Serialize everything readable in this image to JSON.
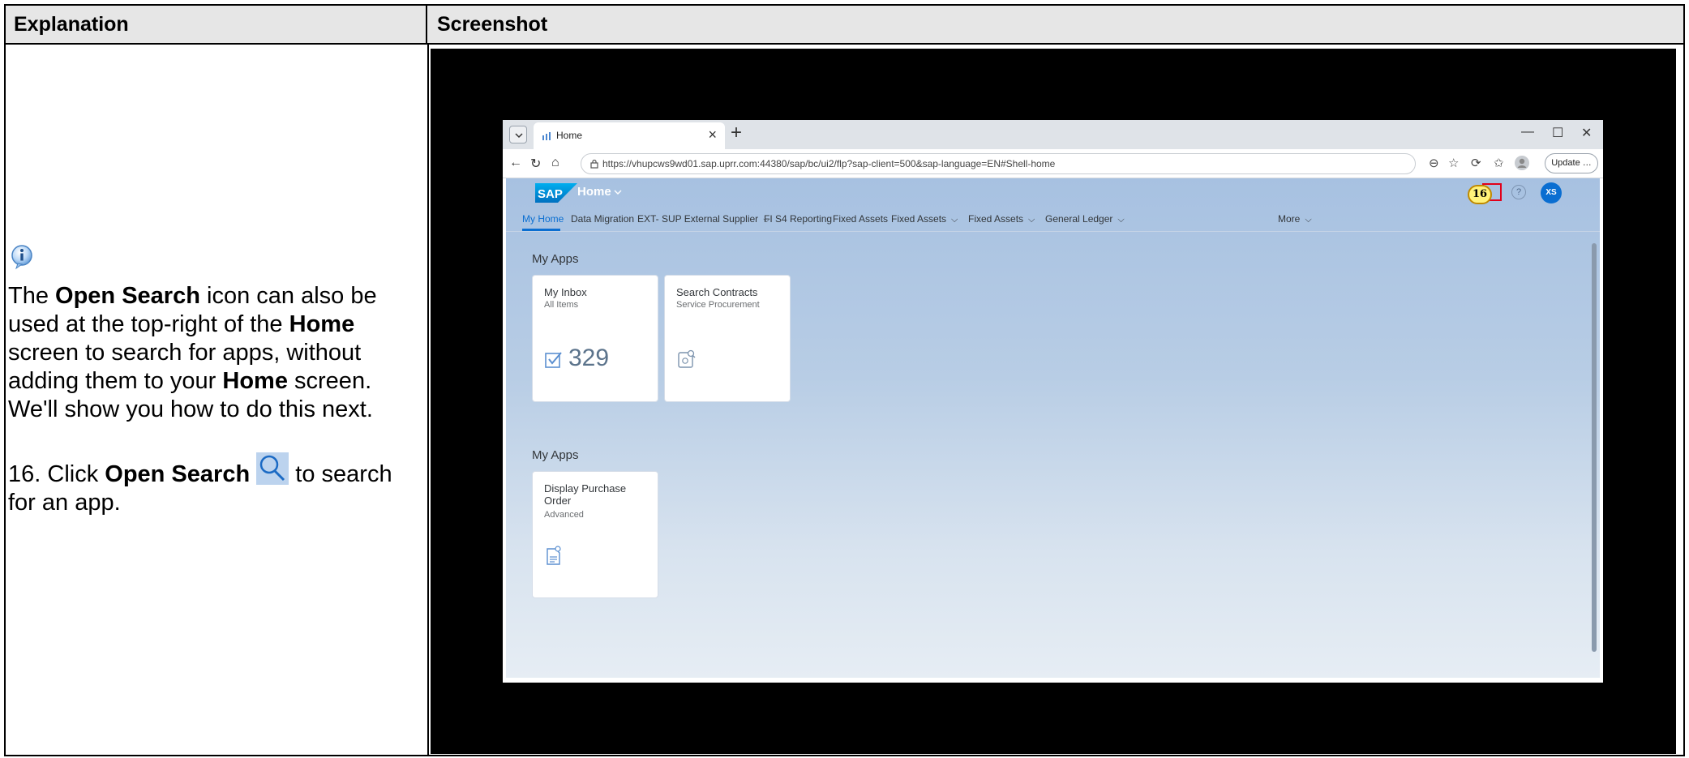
{
  "table": {
    "header_left": "Explanation",
    "header_right": "Screenshot"
  },
  "explanation": {
    "info_icon": "info-icon",
    "p1": [
      "The ",
      "Open Search",
      " icon can also be used at the top-right of the ",
      "Home",
      " screen to search for apps, without adding them to your ",
      "Home",
      " screen. We'll show you how to do this next."
    ],
    "step_prefix": "16. Click ",
    "step_bold": "Open Search",
    "step_suffix": " to search for an app."
  },
  "browser": {
    "tab_title": "Home",
    "url": "https://vhupcws9wd01.sap.uprr.com:44380/sap/bc/ui2/flp?sap-client=500&sap-language=EN#Shell-home",
    "update_label": "Update …"
  },
  "shell": {
    "logo": "SAP",
    "title": "Home",
    "step_badge": "16",
    "avatar_initials": "XS",
    "nav": [
      {
        "label": "My Home",
        "active": true,
        "chevron": false
      },
      {
        "label": "Data Migration",
        "active": false,
        "chevron": false
      },
      {
        "label": "EXT- SUP External Supplier",
        "active": false,
        "chevron": true
      },
      {
        "label": "FI S4 Reporting",
        "active": false,
        "chevron": false
      },
      {
        "label": "Fixed Assets",
        "active": false,
        "chevron": false
      },
      {
        "label": "Fixed Assets",
        "active": false,
        "chevron": true
      },
      {
        "label": "Fixed Assets",
        "active": false,
        "chevron": true
      },
      {
        "label": "General Ledger",
        "active": false,
        "chevron": true
      }
    ],
    "more_label": "More",
    "sections": [
      {
        "title": "My Apps",
        "tiles": [
          {
            "title": "My Inbox",
            "subtitle": "All Items",
            "kpi": "329",
            "icon": "inbox-check-icon"
          },
          {
            "title": "Search Contracts",
            "subtitle": "Service Procurement",
            "kpi": "",
            "icon": "contract-search-icon"
          }
        ]
      },
      {
        "title": "My Apps",
        "tiles": [
          {
            "title": "Display Purchase Order",
            "subtitle": "Advanced",
            "kpi": "",
            "icon": "purchase-order-icon"
          }
        ]
      }
    ]
  }
}
